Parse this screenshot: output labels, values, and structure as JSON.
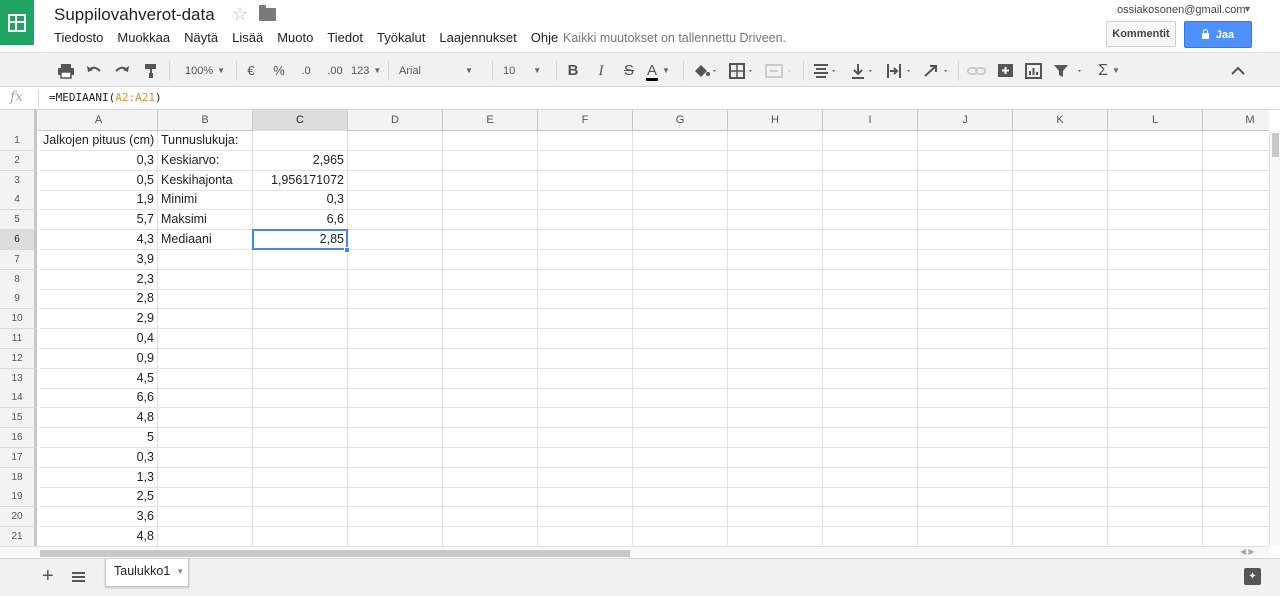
{
  "header": {
    "title": "Suppilovahverot-data",
    "menu": [
      "Tiedosto",
      "Muokkaa",
      "Näytä",
      "Lisää",
      "Muoto",
      "Tiedot",
      "Työkalut",
      "Laajennukset",
      "Ohje"
    ],
    "save_status": "Kaikki muutokset on tallennettu Driveen.",
    "user_email": "ossiakosonen@gmail.com",
    "comments_label": "Kommentit",
    "share_label": "Jaa"
  },
  "toolbar": {
    "zoom": "100%",
    "currency": "€",
    "percent": "%",
    "decrease_decimals": ".0",
    "increase_decimals": ".00",
    "more_formats": "123",
    "font": "Arial",
    "font_size": "10",
    "bold": "B",
    "italic": "I",
    "strike": "S",
    "text_color": "A",
    "functions": "Σ"
  },
  "formula_bar": {
    "fx_label": "fx",
    "prefix": "=MEDIAANI(",
    "ref": "A2:A21",
    "suffix": ")"
  },
  "columns": [
    "A",
    "B",
    "C",
    "D",
    "E",
    "F",
    "G",
    "H",
    "I",
    "J",
    "K",
    "L",
    "M"
  ],
  "selected_column": "C",
  "selected_row": 6,
  "rows": [
    {
      "n": "1",
      "a": "Jalkojen pituus (cm)",
      "b": "Tunnuslukuja:",
      "c": ""
    },
    {
      "n": "2",
      "a": "0,3",
      "b": "Keskiarvo:",
      "c": "2,965"
    },
    {
      "n": "3",
      "a": "0,5",
      "b": "Keskihajonta",
      "c": "1,956171072"
    },
    {
      "n": "4",
      "a": "1,9",
      "b": "Minimi",
      "c": "0,3"
    },
    {
      "n": "5",
      "a": "5,7",
      "b": "Maksimi",
      "c": "6,6"
    },
    {
      "n": "6",
      "a": "4,3",
      "b": "Mediaani",
      "c": "2,85"
    },
    {
      "n": "7",
      "a": "3,9",
      "b": "",
      "c": ""
    },
    {
      "n": "8",
      "a": "2,3",
      "b": "",
      "c": ""
    },
    {
      "n": "9",
      "a": "2,8",
      "b": "",
      "c": ""
    },
    {
      "n": "10",
      "a": "2,9",
      "b": "",
      "c": ""
    },
    {
      "n": "11",
      "a": "0,4",
      "b": "",
      "c": ""
    },
    {
      "n": "12",
      "a": "0,9",
      "b": "",
      "c": ""
    },
    {
      "n": "13",
      "a": "4,5",
      "b": "",
      "c": ""
    },
    {
      "n": "14",
      "a": "6,6",
      "b": "",
      "c": ""
    },
    {
      "n": "15",
      "a": "4,8",
      "b": "",
      "c": ""
    },
    {
      "n": "16",
      "a": "5",
      "b": "",
      "c": ""
    },
    {
      "n": "17",
      "a": "0,3",
      "b": "",
      "c": ""
    },
    {
      "n": "18",
      "a": "1,3",
      "b": "",
      "c": ""
    },
    {
      "n": "19",
      "a": "2,5",
      "b": "",
      "c": ""
    },
    {
      "n": "20",
      "a": "3,6",
      "b": "",
      "c": ""
    },
    {
      "n": "21",
      "a": "4,8",
      "b": "",
      "c": ""
    }
  ],
  "sheets": [
    {
      "name": "Taulukko1"
    }
  ]
}
